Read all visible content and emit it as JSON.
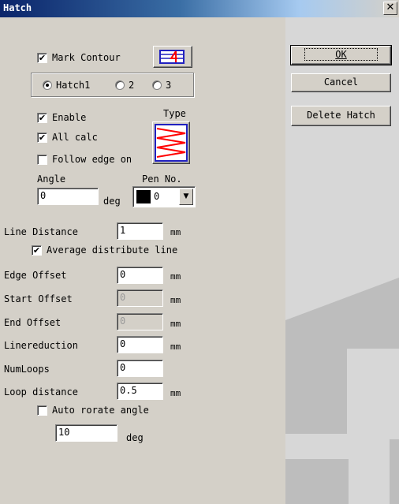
{
  "window": {
    "title": "Hatch",
    "close_glyph": "✕"
  },
  "buttons": {
    "ok": "OK",
    "cancel": "Cancel",
    "delete": "Delete Hatch"
  },
  "contour": {
    "label": "Mark Contour",
    "checked": true,
    "icon": "mark-contour-icon"
  },
  "hatch_tabs": {
    "options": [
      "Hatch1",
      "2",
      "3"
    ],
    "selected": 0
  },
  "options": {
    "enable": {
      "label": "Enable",
      "checked": true
    },
    "all_calc": {
      "label": "All calc",
      "checked": true
    },
    "follow_edge": {
      "label": "Follow edge on",
      "checked": false
    },
    "type_label": "Type",
    "type_icon": "hatch-type-icon"
  },
  "angle": {
    "label": "Angle",
    "value": "0",
    "unit": "deg"
  },
  "pen": {
    "label": "Pen No.",
    "value": "0",
    "color": "#000000"
  },
  "line_distance": {
    "label": "Line Distance",
    "value": "1",
    "unit": "mm"
  },
  "average_distribute": {
    "label": "Average distribute line",
    "checked": true
  },
  "edge_offset": {
    "label": "Edge Offset",
    "value": "0",
    "unit": "mm"
  },
  "start_offset": {
    "label": "Start Offset",
    "value": "0",
    "unit": "mm"
  },
  "end_offset": {
    "label": "End Offset",
    "value": "0",
    "unit": "mm"
  },
  "linereduction": {
    "label": "Linereduction",
    "value": "0",
    "unit": "mm"
  },
  "num_loops": {
    "label": "NumLoops",
    "value": "0"
  },
  "loop_distance": {
    "label": "Loop distance",
    "value": "0.5",
    "unit": "mm"
  },
  "auto_rotate": {
    "label": "Auto rorate angle",
    "checked": false,
    "value": "10",
    "unit": "deg"
  },
  "colors": {
    "title_bar": "#0a246a",
    "dialog_face": "#d4d0c8",
    "contour_icon_accent": "#ff0000",
    "type_icon_lines": "#ff0000"
  }
}
